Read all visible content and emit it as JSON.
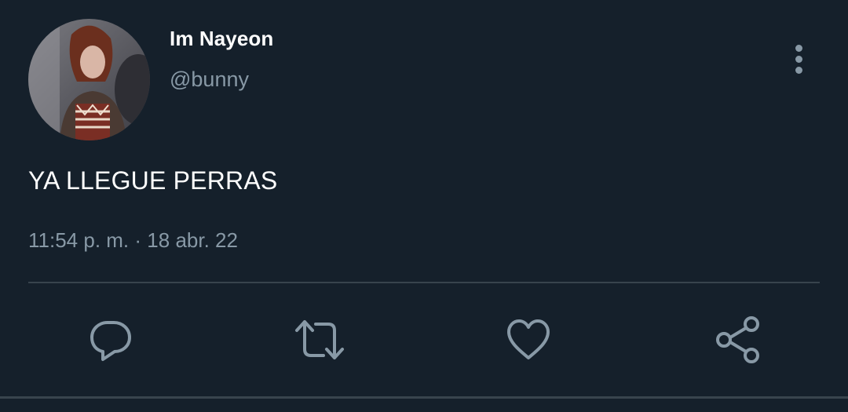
{
  "user": {
    "display_name": "Im Nayeon",
    "handle": "@bunny",
    "avatar_icon": "profile-photo"
  },
  "tweet": {
    "text": "YA LLEGUE PERRAS",
    "time": "11:54 p. m.",
    "separator": "·",
    "date": "18 abr. 22"
  },
  "actions": [
    {
      "name": "reply",
      "icon": "speech-bubble-icon"
    },
    {
      "name": "retweet",
      "icon": "retweet-arrows-icon"
    },
    {
      "name": "like",
      "icon": "heart-icon"
    },
    {
      "name": "share",
      "icon": "share-nodes-icon"
    }
  ],
  "colors": {
    "background": "#15202b",
    "primary_text": "#ffffff",
    "secondary_text": "#8899a6",
    "divider": "#38444d"
  }
}
